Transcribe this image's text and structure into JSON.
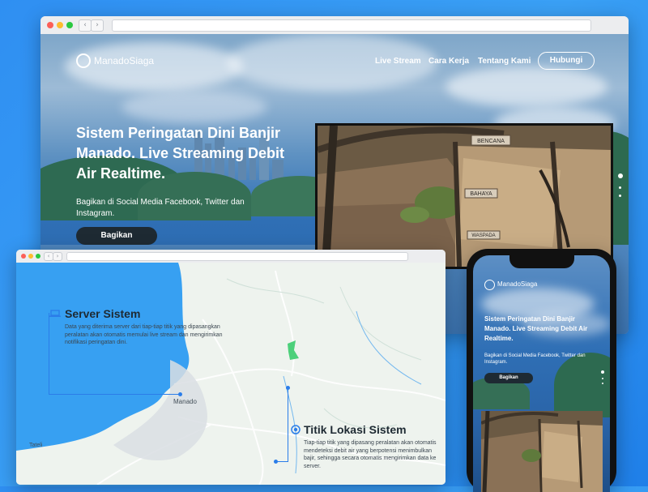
{
  "brand": {
    "name": "ManadoSiaga"
  },
  "nav": {
    "links": [
      "Live Stream",
      "Cara Kerja",
      "Tentang Kami"
    ],
    "cta": "Hubungi"
  },
  "hero": {
    "title": "Sistem Peringatan Dini Banjir Manado. Live Streaming Debit Air Realtime.",
    "subtitle": "Bagikan di Social Media Facebook, Twitter dan Instagram.",
    "button": "Bagikan"
  },
  "camera": {
    "sign_top": "BENCANA",
    "sign_mid": "BAHAYA",
    "sign_low": "WASPADA"
  },
  "map": {
    "server": {
      "title": "Server Sistem",
      "desc": "Data yang diterima server dari tiap-tiap titik yang dipasangkan peralatan akan otomatis memulai live stream dan mengirimkan notifikasi peringatan dini."
    },
    "location": {
      "title": "Titik Lokasi Sistem",
      "desc": "Tiap-tiap titik yang dipasang peralatan akan otomatis mendeteksi debit air yang berpotensi menimbulkan bajir, sehingga secara otomatis mengirimkan data ke server."
    },
    "places": {
      "city": "Manado",
      "small": "Tateli"
    }
  },
  "phone": {
    "brand": "ManadoSiaga",
    "title": "Sistem Peringatan Dini Banjir Manado. Live Streaming Debit Air Realtime.",
    "subtitle": "Bagikan di Social Media Facebook, Twitter dan Instagram.",
    "button": "Bagikan"
  },
  "colors": {
    "accent": "#2b7de9",
    "dark_button": "#1e2a33",
    "sea": "#37a0f2",
    "background": "#2f8ff2"
  }
}
